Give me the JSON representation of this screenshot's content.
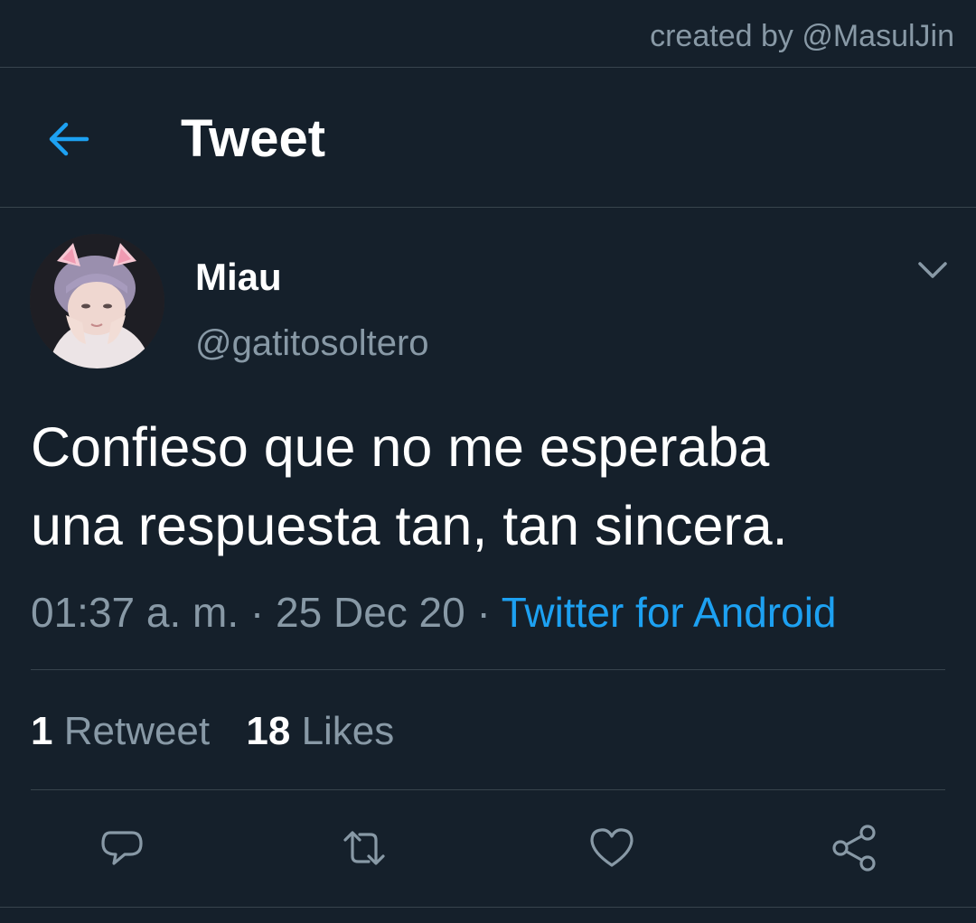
{
  "watermark": "created by @MasulJin",
  "header": {
    "back_icon": "arrow-left-icon",
    "title": "Tweet"
  },
  "author": {
    "display_name": "Miau",
    "handle": "@gatitosoltero",
    "menu_icon": "chevron-down-icon"
  },
  "tweet": {
    "text_lines": [
      "Confieso que no me esperaba",
      "una respuesta tan, tan sincera."
    ],
    "time": "01:37 a. m.",
    "date": "25 Dec 20",
    "separator": "·",
    "source": "Twitter for Android"
  },
  "stats": {
    "retweets": "1",
    "retweets_label": "Retweet",
    "likes": "18",
    "likes_label": "Likes"
  },
  "actions": [
    "reply-icon",
    "retweet-icon",
    "like-icon",
    "share-icon"
  ],
  "colors": {
    "background": "#15202b",
    "accent": "#1da1f2",
    "muted": "#8899a6",
    "divider": "#38444d"
  }
}
